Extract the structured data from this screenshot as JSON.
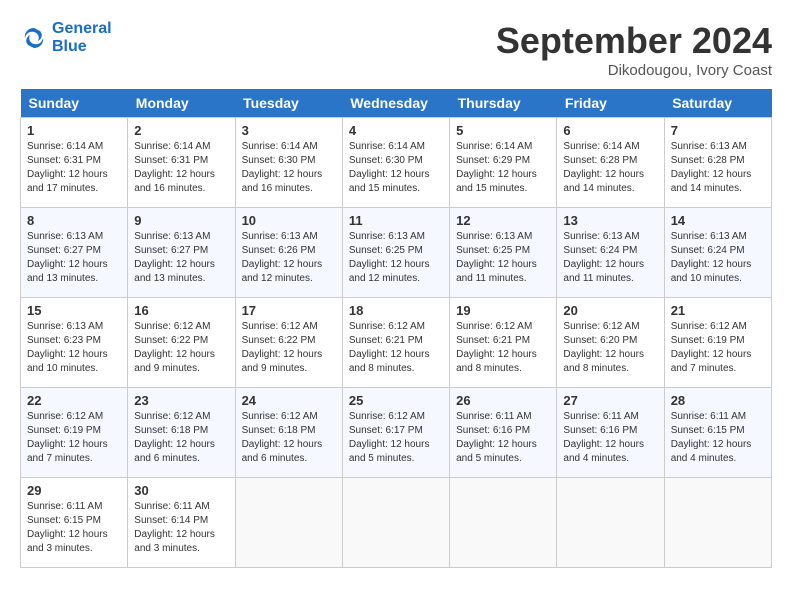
{
  "header": {
    "logo_line1": "General",
    "logo_line2": "Blue",
    "month": "September 2024",
    "location": "Dikodougou, Ivory Coast"
  },
  "days_of_week": [
    "Sunday",
    "Monday",
    "Tuesday",
    "Wednesday",
    "Thursday",
    "Friday",
    "Saturday"
  ],
  "weeks": [
    [
      {
        "num": "1",
        "sunrise": "6:14 AM",
        "sunset": "6:31 PM",
        "daylight": "12 hours and 17 minutes."
      },
      {
        "num": "2",
        "sunrise": "6:14 AM",
        "sunset": "6:31 PM",
        "daylight": "12 hours and 16 minutes."
      },
      {
        "num": "3",
        "sunrise": "6:14 AM",
        "sunset": "6:30 PM",
        "daylight": "12 hours and 16 minutes."
      },
      {
        "num": "4",
        "sunrise": "6:14 AM",
        "sunset": "6:30 PM",
        "daylight": "12 hours and 15 minutes."
      },
      {
        "num": "5",
        "sunrise": "6:14 AM",
        "sunset": "6:29 PM",
        "daylight": "12 hours and 15 minutes."
      },
      {
        "num": "6",
        "sunrise": "6:14 AM",
        "sunset": "6:28 PM",
        "daylight": "12 hours and 14 minutes."
      },
      {
        "num": "7",
        "sunrise": "6:13 AM",
        "sunset": "6:28 PM",
        "daylight": "12 hours and 14 minutes."
      }
    ],
    [
      {
        "num": "8",
        "sunrise": "6:13 AM",
        "sunset": "6:27 PM",
        "daylight": "12 hours and 13 minutes."
      },
      {
        "num": "9",
        "sunrise": "6:13 AM",
        "sunset": "6:27 PM",
        "daylight": "12 hours and 13 minutes."
      },
      {
        "num": "10",
        "sunrise": "6:13 AM",
        "sunset": "6:26 PM",
        "daylight": "12 hours and 12 minutes."
      },
      {
        "num": "11",
        "sunrise": "6:13 AM",
        "sunset": "6:25 PM",
        "daylight": "12 hours and 12 minutes."
      },
      {
        "num": "12",
        "sunrise": "6:13 AM",
        "sunset": "6:25 PM",
        "daylight": "12 hours and 11 minutes."
      },
      {
        "num": "13",
        "sunrise": "6:13 AM",
        "sunset": "6:24 PM",
        "daylight": "12 hours and 11 minutes."
      },
      {
        "num": "14",
        "sunrise": "6:13 AM",
        "sunset": "6:24 PM",
        "daylight": "12 hours and 10 minutes."
      }
    ],
    [
      {
        "num": "15",
        "sunrise": "6:13 AM",
        "sunset": "6:23 PM",
        "daylight": "12 hours and 10 minutes."
      },
      {
        "num": "16",
        "sunrise": "6:12 AM",
        "sunset": "6:22 PM",
        "daylight": "12 hours and 9 minutes."
      },
      {
        "num": "17",
        "sunrise": "6:12 AM",
        "sunset": "6:22 PM",
        "daylight": "12 hours and 9 minutes."
      },
      {
        "num": "18",
        "sunrise": "6:12 AM",
        "sunset": "6:21 PM",
        "daylight": "12 hours and 8 minutes."
      },
      {
        "num": "19",
        "sunrise": "6:12 AM",
        "sunset": "6:21 PM",
        "daylight": "12 hours and 8 minutes."
      },
      {
        "num": "20",
        "sunrise": "6:12 AM",
        "sunset": "6:20 PM",
        "daylight": "12 hours and 8 minutes."
      },
      {
        "num": "21",
        "sunrise": "6:12 AM",
        "sunset": "6:19 PM",
        "daylight": "12 hours and 7 minutes."
      }
    ],
    [
      {
        "num": "22",
        "sunrise": "6:12 AM",
        "sunset": "6:19 PM",
        "daylight": "12 hours and 7 minutes."
      },
      {
        "num": "23",
        "sunrise": "6:12 AM",
        "sunset": "6:18 PM",
        "daylight": "12 hours and 6 minutes."
      },
      {
        "num": "24",
        "sunrise": "6:12 AM",
        "sunset": "6:18 PM",
        "daylight": "12 hours and 6 minutes."
      },
      {
        "num": "25",
        "sunrise": "6:12 AM",
        "sunset": "6:17 PM",
        "daylight": "12 hours and 5 minutes."
      },
      {
        "num": "26",
        "sunrise": "6:11 AM",
        "sunset": "6:16 PM",
        "daylight": "12 hours and 5 minutes."
      },
      {
        "num": "27",
        "sunrise": "6:11 AM",
        "sunset": "6:16 PM",
        "daylight": "12 hours and 4 minutes."
      },
      {
        "num": "28",
        "sunrise": "6:11 AM",
        "sunset": "6:15 PM",
        "daylight": "12 hours and 4 minutes."
      }
    ],
    [
      {
        "num": "29",
        "sunrise": "6:11 AM",
        "sunset": "6:15 PM",
        "daylight": "12 hours and 3 minutes."
      },
      {
        "num": "30",
        "sunrise": "6:11 AM",
        "sunset": "6:14 PM",
        "daylight": "12 hours and 3 minutes."
      },
      null,
      null,
      null,
      null,
      null
    ]
  ]
}
